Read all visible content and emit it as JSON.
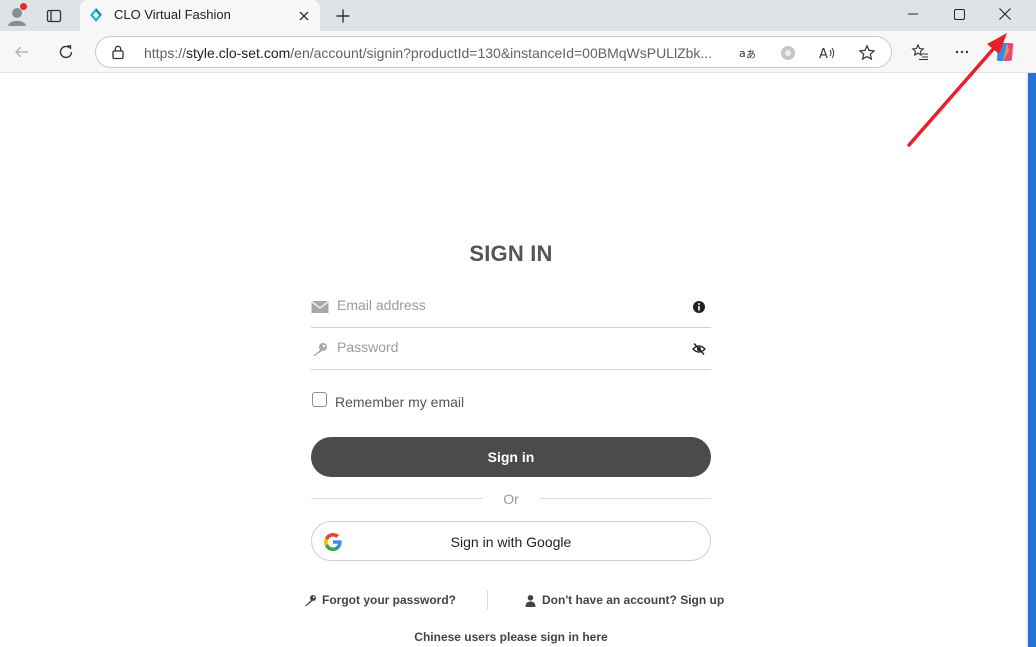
{
  "browser": {
    "tab": {
      "title": "CLO Virtual Fashion"
    },
    "address": {
      "url_prefix": "https://",
      "url_host": "style.clo-set.com",
      "url_rest": "/en/account/signin?productId=130&instanceId=00BMqWsPULlZbk..."
    },
    "colors": {
      "accent_scrollbar": "#2a6fd6",
      "annotation_arrow": "#e8202a"
    }
  },
  "signin": {
    "title": "SIGN IN",
    "email": {
      "placeholder": "Email address",
      "value": ""
    },
    "password": {
      "placeholder": "Password",
      "value": ""
    },
    "remember_label": "Remember my email",
    "remember_checked": false,
    "signin_button": "Sign in",
    "or_text": "Or",
    "google_button": "Sign in with Google",
    "forgot_password": "Forgot your password?",
    "signup": "Don't have an account? Sign up",
    "chinese_signin": "Chinese users please sign in here",
    "button_color": "#4b4b4c"
  }
}
